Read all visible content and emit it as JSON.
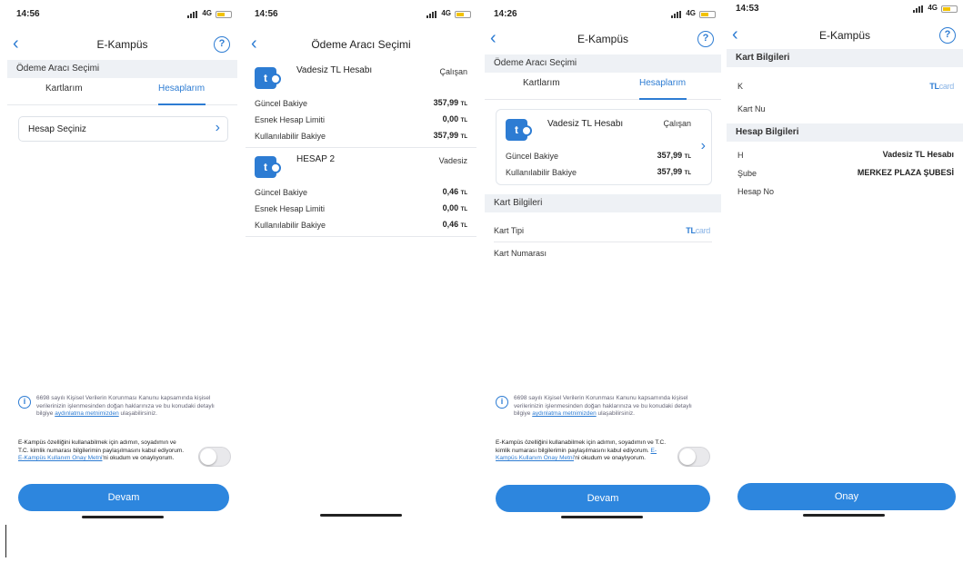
{
  "colors": {
    "accent": "#2d7cd3",
    "button": "#2d86de",
    "section_bg": "#eef1f5"
  },
  "icons": {
    "back": "chevron-left-icon",
    "help": "question-circle-icon",
    "info": "info-circle-icon",
    "account": "tl-account-icon"
  },
  "s1": {
    "time": "14:56",
    "net": "4G",
    "title": "E-Kampüs",
    "help": "?",
    "section": "Ödeme Aracı Seçimi",
    "tab_cards": "Kartlarım",
    "tab_accounts": "Hesaplarım",
    "select_label": "Hesap Seçiniz",
    "info_icon": "i",
    "info_text_1": "6698 sayılı Kişisel Verilerin Korunması Kanunu kapsamında kişisel verilerinizin işlenmesinden doğan haklarınıza ve bu konudaki detaylı bilgiye ",
    "info_link": "aydınlatma metnimizden",
    "info_text_2": " ulaşabilirsiniz.",
    "consent_text_1": "E-Kampüs özelliğini kullanabilmek için adımın, soyadımın ve T.C. kimlik numarası bilgilerimin paylaşılmasını kabul ediyorum. ",
    "consent_link": "E-Kampüs Kullanım Onay Metni",
    "consent_text_2": "'ni okudum ve onaylıyorum.",
    "button": "Devam"
  },
  "s2": {
    "time": "14:56",
    "net": "4G",
    "title": "Ödeme Aracı Seçimi",
    "accounts": [
      {
        "icon": "t",
        "name": "Vadesiz TL Hesabı",
        "branch": "Çalışan",
        "rows": [
          {
            "label": "Güncel Bakiye",
            "value": "357,99",
            "unit": "TL"
          },
          {
            "label": "Esnek Hesap Limiti",
            "value": "0,00",
            "unit": "TL"
          },
          {
            "label": "Kullanılabilir Bakiye",
            "value": "357,99",
            "unit": "TL"
          }
        ]
      },
      {
        "icon": "t",
        "name": "HESAP 2",
        "branch": "Vadesiz",
        "rows": [
          {
            "label": "Güncel Bakiye",
            "value": "0,46",
            "unit": "TL"
          },
          {
            "label": "Esnek Hesap Limiti",
            "value": "0,00",
            "unit": "TL"
          },
          {
            "label": "Kullanılabilir Bakiye",
            "value": "0,46",
            "unit": "TL"
          }
        ]
      }
    ]
  },
  "s3": {
    "time": "14:26",
    "net": "4G",
    "title": "E-Kampüs",
    "help": "?",
    "section": "Ödeme Aracı Seçimi",
    "tab_cards": "Kartlarım",
    "tab_accounts": "Hesaplarım",
    "account": {
      "icon": "t",
      "name": "Vadesiz TL Hesabı",
      "branch": "Çalışan",
      "rows": [
        {
          "label": "Güncel Bakiye",
          "value": "357,99",
          "unit": "TL"
        },
        {
          "label": "Kullanılabilir Bakiye",
          "value": "357,99",
          "unit": "TL"
        }
      ]
    },
    "card_section": "Kart Bilgileri",
    "card_type_label": "Kart Tipi",
    "card_brand_a": "TL",
    "card_brand_b": "card",
    "card_number_label": "Kart Numarası",
    "info_icon": "i",
    "info_text_1": "6698 sayılı Kişisel Verilerin Korunması Kanunu kapsamında kişisel verilerinizin işlenmesinden doğan haklarınıza ve bu konudaki detaylı bilgiye ",
    "info_link": "aydınlatma metnimizden",
    "info_text_2": " ulaşabilirsiniz.",
    "consent_text_1": "E-Kampüs özelliğini kullanabilmek için adımın, soyadımın ve T.C. kimlik numarası bilgilerimin paylaşılmasını kabul ediyorum. ",
    "consent_link": "E-Kampüs Kullanım Onay Metni",
    "consent_text_2": "'ni okudum ve onaylıyorum.",
    "button": "Devam"
  },
  "s4": {
    "time": "14:53",
    "net": "4G",
    "title": "E-Kampüs",
    "help": "?",
    "card_section": "Kart Bilgileri",
    "card_type_label": "K",
    "card_brand_a": "TL",
    "card_brand_b": "card",
    "card_number_label": "Kart Nu",
    "account_section": "Hesap Bilgileri",
    "account_type_label": "H",
    "account_type_value": "Vadesiz TL Hesabı",
    "branch_label": "Şube",
    "branch_value": "MERKEZ PLAZA ŞUBESİ",
    "account_no_label": "Hesap No",
    "button": "Onay"
  }
}
